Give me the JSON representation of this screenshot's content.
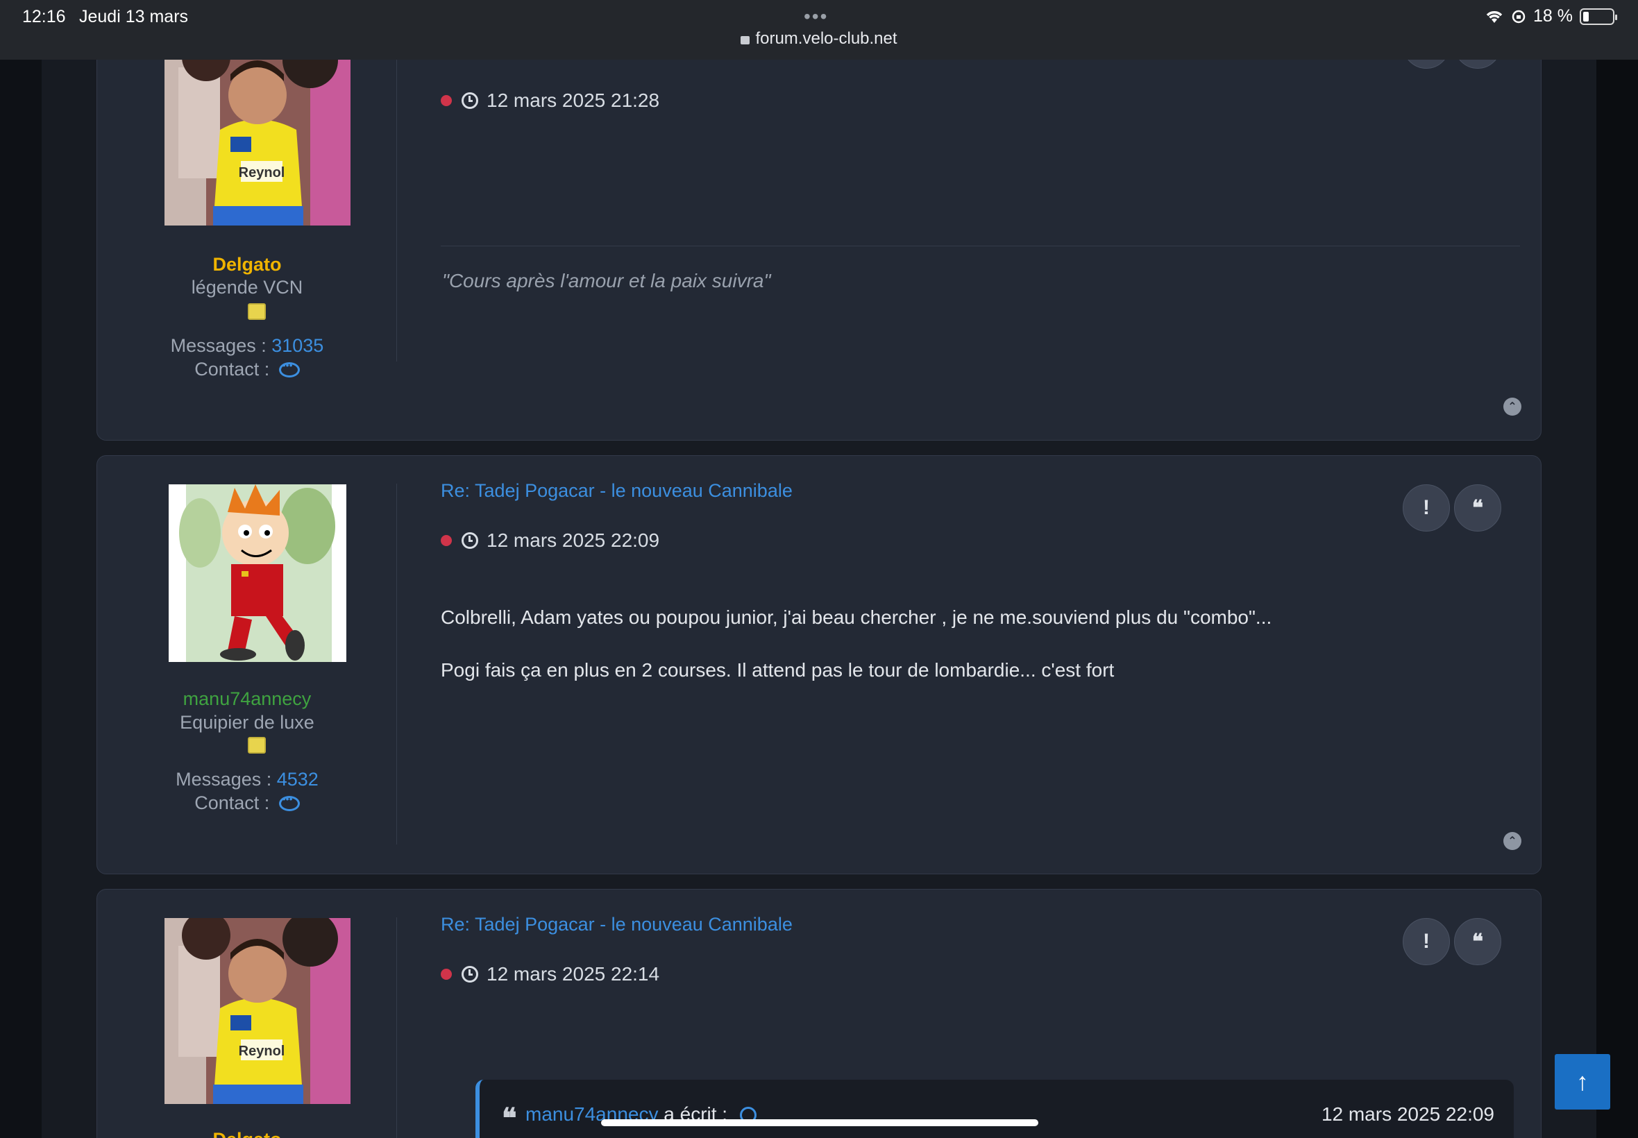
{
  "status_bar": {
    "time": "12:16",
    "date": "Jeudi 13 mars",
    "url": "forum.velo-club.net",
    "battery": "18 %"
  },
  "posts": [
    {
      "author": "Delgato",
      "author_color": "#f0b400",
      "rank": "légende VCN",
      "messages_label": "Messages :",
      "messages_count": "31035",
      "contact_label": "Contact :",
      "date": "12 mars 2025 21:28",
      "signature": "\"Cours après l'amour et la paix suivra\""
    },
    {
      "title": "Re: Tadej Pogacar - le nouveau Cannibale",
      "author": "manu74annecy",
      "author_color": "#3fa340",
      "rank": "Equipier de luxe",
      "messages_label": "Messages :",
      "messages_count": "4532",
      "contact_label": "Contact :",
      "date": "12 mars 2025 22:09",
      "body": [
        "Colbrelli, Adam yates ou poupou junior, j'ai beau chercher , je ne me.souviend plus du \"combo\"...",
        "Pogi fais ça en plus en 2 courses. Il attend pas le tour de lombardie... c'est fort"
      ]
    },
    {
      "title": "Re: Tadej Pogacar - le nouveau Cannibale",
      "author": "Delgato",
      "author_color": "#f0b400",
      "date": "12 mars 2025 22:14",
      "quote": {
        "author": "manu74annecy",
        "wrote": "a écrit :",
        "date": "12 mars 2025 22:09"
      }
    }
  ],
  "buttons": {
    "report": "!",
    "quote": "❝",
    "back_to_top": "↑",
    "post_top": "⌃"
  },
  "colors": {
    "accent": "#3c8fe0",
    "card_bg": "#232935",
    "page_bg": "#171b22"
  }
}
